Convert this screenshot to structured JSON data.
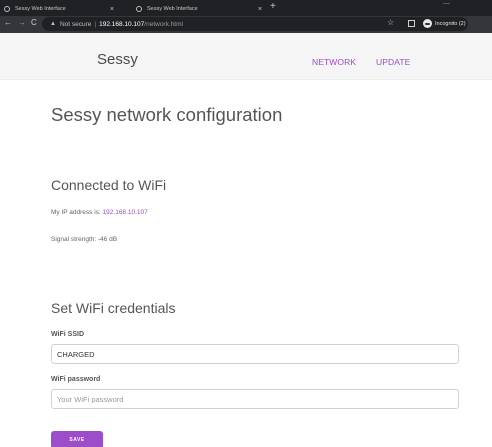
{
  "browser": {
    "tabs": [
      {
        "title": "Sessy Web Interface",
        "close": "×"
      },
      {
        "title": "Sessy Web Interface",
        "close": "×"
      }
    ],
    "new_tab": "+",
    "nav": {
      "back": "←",
      "forward": "→",
      "reload": "C"
    },
    "security_label": "Not secure",
    "url_host": "192.168.10.107",
    "url_path": "/network.html",
    "profile_label": "Incognito (2)"
  },
  "site": {
    "brand": "Sessy",
    "nav": {
      "network": "NETWORK",
      "update": "UPDATE"
    },
    "accent_color": "#9b4dca"
  },
  "page": {
    "title": "Sessy network configuration",
    "wifi_status": {
      "heading": "Connected to WiFi",
      "ip_label": "My IP address is: ",
      "ip_value": "192.168.10.107",
      "signal": "Signal strength: -46 dB"
    },
    "credentials": {
      "heading": "Set WiFi credentials",
      "ssid_label": "WiFi SSID",
      "ssid_value": "CHARGED",
      "password_label": "WiFi password",
      "password_placeholder": "Your WiFi password",
      "save_label": "SAVE"
    }
  }
}
